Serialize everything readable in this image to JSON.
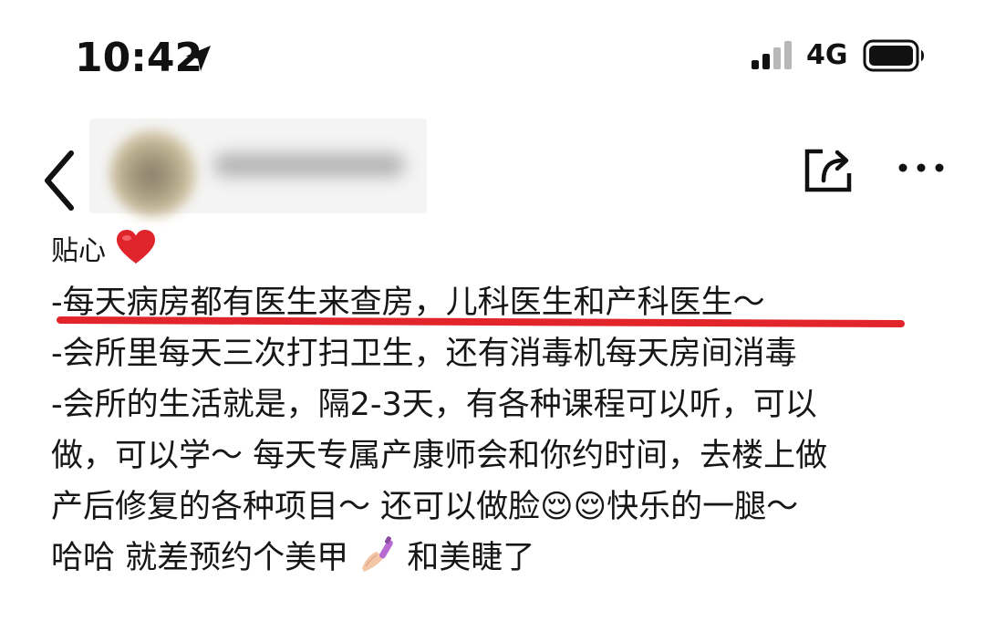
{
  "status_bar": {
    "time": "10:42",
    "network": "4G",
    "icons": [
      "location-arrow-icon",
      "signal-bars-icon",
      "battery-icon"
    ]
  },
  "nav_bar": {
    "icons": [
      "back-chevron-icon",
      "share-icon",
      "more-dots-icon"
    ]
  },
  "post": {
    "title": "贴心",
    "lines": [
      "-每天病房都有医生来查房，儿科医生和产科医生～",
      "-会所里每天三次打扫卫生，还有消毒机每天房间消毒",
      "-会所的生活就是，隔2-3天，有各种课程可以听，可以",
      "做，可以学～ 每天专属产康师会和你约时间，去楼上做",
      "产后修复的各种项目～ 还可以做脸😌😌快乐的一腿～",
      "哈哈 就差预约个美甲",
      "和美睫了"
    ],
    "icons": {
      "title_emoji": "❤️",
      "inline_emoji": "💅"
    }
  },
  "colors": {
    "underline": "#e2252b",
    "text": "#161616",
    "heart": "#e0242b"
  }
}
